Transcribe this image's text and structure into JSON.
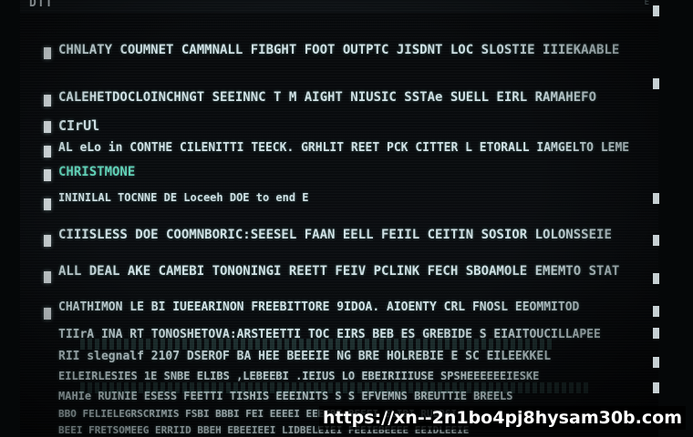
{
  "window": {
    "title": "DTT",
    "corner": "E"
  },
  "lines": [
    {
      "text": "CHNLATY COUMNET CAMMNALL FIBGHT FOOT OUTPTC  JISDNT  LOC  SLOSTIE IIIEKAABLE",
      "style": ""
    },
    {
      "text": "CALEHETDOCLOINCHNGT  SEEINNC T M AIGHT  NIUSIC  SSTAe SUELL  EIRL RAMAHEFO",
      "style": ""
    },
    {
      "text": "CIrUl",
      "style": ""
    },
    {
      "text": "AL eLo  in  CONTHE CILENITTI TEECK. GRHLIT  REET  PCK  CITTER  L  ETORALL IAMGELTO LEME",
      "style": ""
    },
    {
      "text": "CHRISTMONE",
      "style": "teal"
    },
    {
      "text": "ININILAL TOCNNE DE   Loceeh DOE  to  end E",
      "style": "dim"
    },
    {
      "text": "CIIISLESS DOE  COOMNBORIC:SEESEL  FAAN  EELL  FEIIL  CEITIN  SOSIOR  LOLONSSEIE",
      "style": ""
    },
    {
      "text": "ALL  DEAL  AKE  CAMEBI  TONONINGI  REETT  FEIV  PCLINK  FECH SBOAMOLE  EMEMTO STAT",
      "style": ""
    },
    {
      "text": "CHATHIMON  LE  BI  IUEEARINON  FREEBITTORE  9IDOA. AIOENTY  CRL  FNOSL  EEOMMITOD",
      "style": ""
    },
    {
      "text": "TIIrA  INA  RT  TONOSHETOVA:ARSTEETTI TOC  EIRS  BEB  ES  GREBIDE  S  EIAITOUCILLAPEE",
      "style": "dim"
    },
    {
      "text": "RII  slegnalf  2107  DSEROF  BA  HEE  BEEEIE  NG  BRE  HOLREBIE  E  SC  EILEEKKEL",
      "style": "dim"
    },
    {
      "text": "EILEIRLESIES  1E  SNBE  ELIBS  ,LEBEEBI  .IEIUS  LO  EBEIRIIIUSE  SPSHEEEEEEIESKE",
      "style": "dim"
    },
    {
      "text": "MAHIe  RUINIE  ESESS  FEETTI TISHIS  EEEINITS  S  S  EFVEMNS  BREUTTIE  BREELS",
      "style": "dim"
    },
    {
      "text": "BBO  FELIELEGRSCRIMIS  FSBI  BBBI  FEI  EEEEI  EEEEBE  BEEFI  ELIBI  RUEBSI",
      "style": "dim"
    },
    {
      "text": "BEEI  FRETSOMEEG  ERRIID  BBEH  EBEEIEEI  LIDBELEIEI  FEEIEBEEEE  EEIDLEEIE",
      "style": "dim"
    }
  ],
  "url": "https://xn--2n1bo4pj8hysam30b.com"
}
